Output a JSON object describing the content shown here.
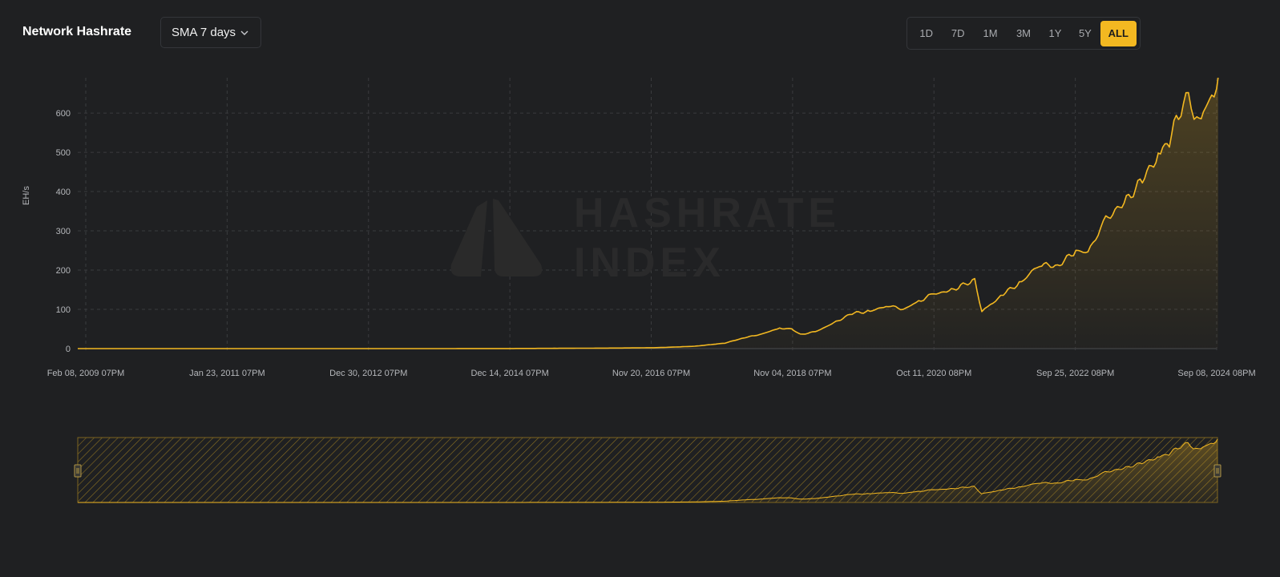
{
  "header": {
    "title": "Network Hashrate"
  },
  "sma_select": {
    "value": "SMA 7 days",
    "icon": "chevron-down-icon"
  },
  "ranges": [
    {
      "label": "1D",
      "active": false
    },
    {
      "label": "7D",
      "active": false
    },
    {
      "label": "1M",
      "active": false
    },
    {
      "label": "3M",
      "active": false
    },
    {
      "label": "1Y",
      "active": false
    },
    {
      "label": "5Y",
      "active": false
    },
    {
      "label": "ALL",
      "active": true
    }
  ],
  "watermark": {
    "line1": "HASHRATE",
    "line2": "INDEX"
  },
  "colors": {
    "background": "#1f2022",
    "accent": "#f3b821",
    "grid": "#3a3b3e",
    "tick_text": "#b5b7bb"
  },
  "chart_data": {
    "type": "area",
    "title": "",
    "xlabel": "",
    "ylabel": "EH/s",
    "ylim": [
      0,
      690
    ],
    "yticks": [
      0,
      100,
      200,
      300,
      400,
      500,
      600
    ],
    "xticks": [
      "Feb 08, 2009 07PM",
      "Jan 23, 2011 07PM",
      "Dec 30, 2012 07PM",
      "Dec 14, 2014 07PM",
      "Nov 20, 2016 07PM",
      "Nov 04, 2018 07PM",
      "Oct 11, 2020 08PM",
      "Sep 25, 2022 08PM",
      "Sep 08, 2024 08PM"
    ],
    "grid": true,
    "series": [
      {
        "x": [
          "2009-01-09",
          "2010-01-01",
          "2011-01-01",
          "2012-01-01",
          "2013-01-01",
          "2014-01-01",
          "2015-01-01",
          "2016-01-01",
          "2016-07-01",
          "2017-01-01",
          "2017-07-01",
          "2017-12-01",
          "2018-03-01",
          "2018-06-01",
          "2018-09-01",
          "2018-11-01",
          "2018-12-15",
          "2019-03-01",
          "2019-06-01",
          "2019-09-01",
          "2019-12-01",
          "2020-03-01",
          "2020-05-15",
          "2020-08-01",
          "2020-10-15",
          "2021-01-01",
          "2021-03-01",
          "2021-05-10",
          "2021-06-15",
          "2021-07-15",
          "2021-10-01",
          "2022-01-01",
          "2022-04-01",
          "2022-07-01",
          "2022-10-01",
          "2022-12-01",
          "2023-03-01",
          "2023-06-01",
          "2023-09-01",
          "2023-12-01",
          "2024-01-15",
          "2024-03-01",
          "2024-04-20",
          "2024-06-01",
          "2024-07-15",
          "2024-08-15",
          "2024-09-08",
          "2024-09-16"
        ],
        "values": [
          0,
          0,
          0,
          0,
          0.02,
          0.05,
          0.3,
          1.0,
          1.5,
          2.5,
          6,
          14,
          27,
          37,
          52,
          50,
          36,
          43,
          65,
          90,
          95,
          110,
          100,
          120,
          140,
          145,
          160,
          175,
          95,
          105,
          140,
          170,
          215,
          210,
          250,
          245,
          330,
          370,
          430,
          500,
          530,
          600,
          640,
          580,
          620,
          640,
          680,
          690
        ]
      }
    ]
  },
  "navigator": {
    "description_free": true
  }
}
